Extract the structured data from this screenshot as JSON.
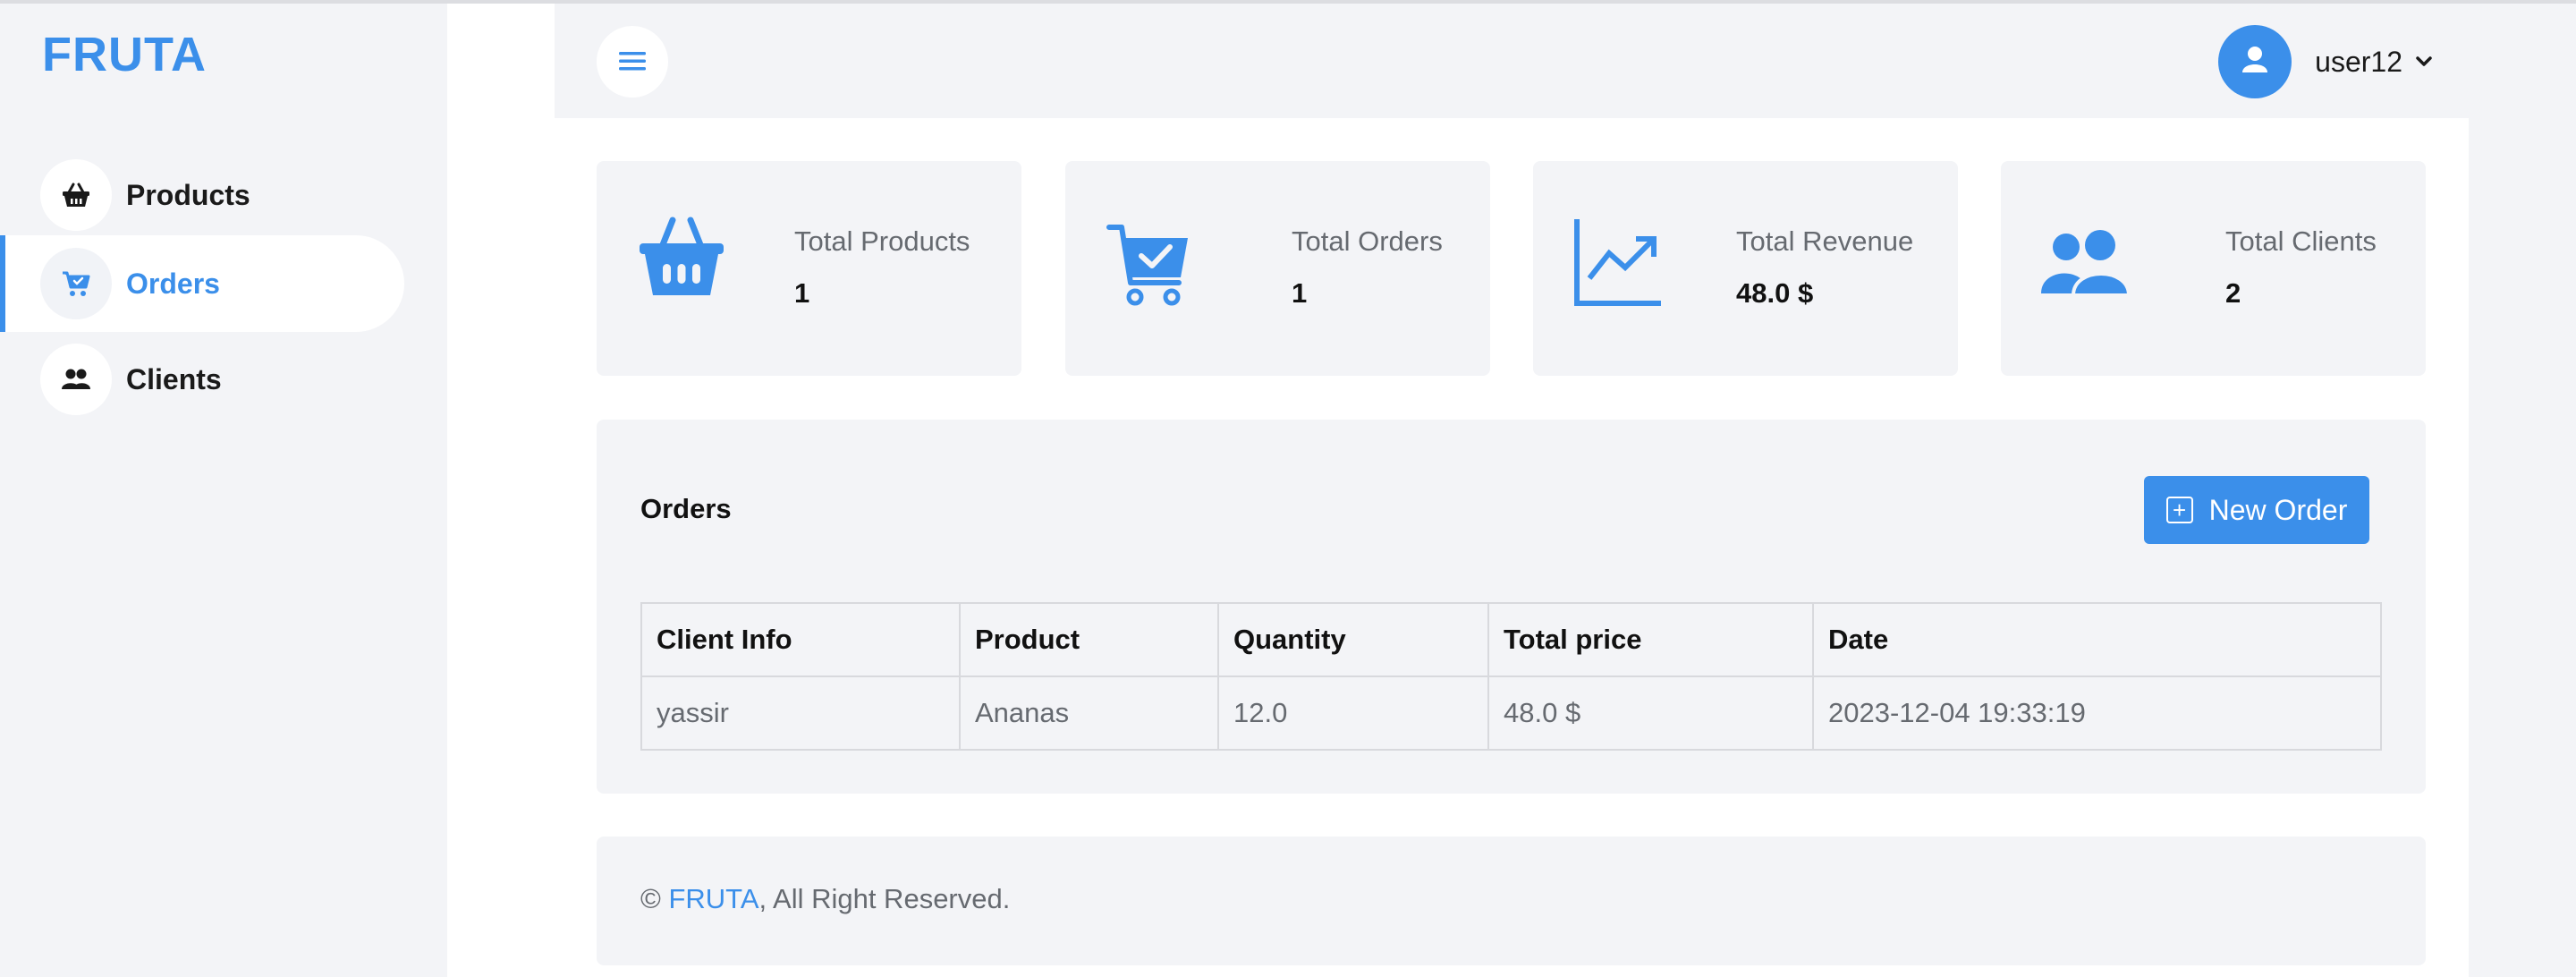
{
  "brand": "FRUTA",
  "sidebar": {
    "items": [
      {
        "label": "Products",
        "icon": "basket-icon",
        "active": false
      },
      {
        "label": "Orders",
        "icon": "cart-icon",
        "active": true
      },
      {
        "label": "Clients",
        "icon": "users-icon",
        "active": false
      }
    ]
  },
  "header": {
    "username": "user12"
  },
  "stats": [
    {
      "title": "Total Products",
      "value": "1",
      "icon": "basket-icon"
    },
    {
      "title": "Total Orders",
      "value": "1",
      "icon": "cart-check-icon"
    },
    {
      "title": "Total Revenue",
      "value": "48.0 $",
      "icon": "chart-line-icon"
    },
    {
      "title": "Total Clients",
      "value": "2",
      "icon": "users-icon"
    }
  ],
  "orders": {
    "title": "Orders",
    "new_button": "New Order",
    "columns": [
      "Client Info",
      "Product",
      "Quantity",
      "Total price",
      "Date"
    ],
    "rows": [
      [
        "yassir",
        "Ananas",
        "12.0",
        "48.0 $",
        "2023-12-04 19:33:19"
      ]
    ]
  },
  "footer": {
    "prefix": "© ",
    "link": "FRUTA",
    "suffix": ", All Right Reserved."
  },
  "colors": {
    "accent": "#3b8fea",
    "panel_bg": "#f3f4f7"
  }
}
